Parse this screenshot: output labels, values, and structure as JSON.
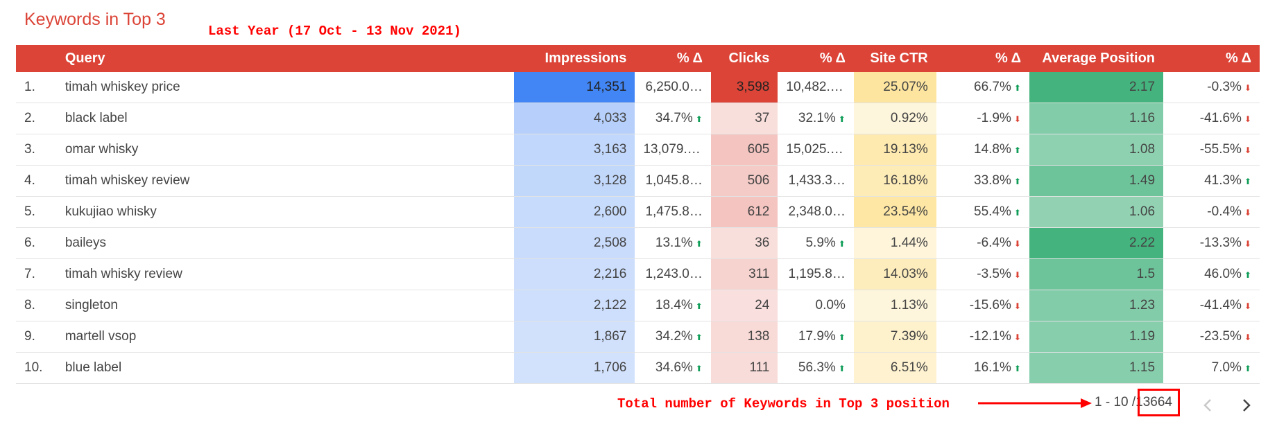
{
  "title": "Keywords in Top 3",
  "annotation_top": "Last Year (17 Oct - 13 Nov 2021)",
  "colors": {
    "header_bg": "#db4437",
    "annotation_red": "#ff0000",
    "impressions_rgb": "66,133,244",
    "clicks_rgb": "219,68,55",
    "ctr_rgb": "251,188,4",
    "position_rgb": "15,157,88"
  },
  "columns": [
    "Query",
    "Impressions",
    "% Δ",
    "Clicks",
    "% Δ",
    "Site CTR",
    "% Δ",
    "Average Position",
    "% Δ"
  ],
  "rows": [
    {
      "idx": "1.",
      "query": "timah whiskey price",
      "impressions": "14,351",
      "imp_delta": "6,250.0…",
      "clicks": "3,598",
      "clk_delta": "10,482.4…",
      "ctr": "25.07%",
      "ctr_delta": "66.7%",
      "ctr_dir": "up",
      "pos": "2.17",
      "pos_delta": "-0.3%",
      "pos_dir": "down",
      "imp_i": 1.0,
      "clk_i": 1.0,
      "ctr_i": 0.6,
      "pos_i": 0.75
    },
    {
      "idx": "2.",
      "query": "black label",
      "impressions": "4,033",
      "imp_delta": "34.7%",
      "imp_dir": "up",
      "clicks": "37",
      "clk_delta": "32.1%",
      "clk_dir": "up",
      "ctr": "0.92%",
      "ctr_delta": "-1.9%",
      "ctr_dir": "down",
      "pos": "1.16",
      "pos_delta": "-41.6%",
      "pos_dir": "down",
      "imp_i": 0.3,
      "clk_i": 0.06,
      "ctr_i": 0.05,
      "pos_i": 0.45
    },
    {
      "idx": "3.",
      "query": "omar whisky",
      "impressions": "3,163",
      "imp_delta": "13,079.2…",
      "clicks": "605",
      "clk_delta": "15,025.0…",
      "ctr": "19.13%",
      "ctr_delta": "14.8%",
      "ctr_dir": "up",
      "pos": "1.08",
      "pos_delta": "-55.5%",
      "pos_dir": "down",
      "imp_i": 0.24,
      "clk_i": 0.22,
      "ctr_i": 0.45,
      "pos_i": 0.4
    },
    {
      "idx": "4.",
      "query": "timah whiskey review",
      "impressions": "3,128",
      "imp_delta": "1,045.8…",
      "clicks": "506",
      "clk_delta": "1,433.3…",
      "ctr": "16.18%",
      "ctr_delta": "33.8%",
      "ctr_dir": "up",
      "pos": "1.49",
      "pos_delta": "41.3%",
      "pos_dir": "up",
      "imp_i": 0.23,
      "clk_i": 0.18,
      "ctr_i": 0.38,
      "pos_i": 0.55
    },
    {
      "idx": "5.",
      "query": "kukujiao whisky",
      "impressions": "2,600",
      "imp_delta": "1,475.8…",
      "clicks": "612",
      "clk_delta": "2,348.0…",
      "ctr": "23.54%",
      "ctr_delta": "55.4%",
      "ctr_dir": "up",
      "pos": "1.06",
      "pos_delta": "-0.4%",
      "pos_dir": "down",
      "imp_i": 0.2,
      "clk_i": 0.22,
      "ctr_i": 0.55,
      "pos_i": 0.38
    },
    {
      "idx": "6.",
      "query": "baileys",
      "impressions": "2,508",
      "imp_delta": "13.1%",
      "imp_dir": "up",
      "clicks": "36",
      "clk_delta": "5.9%",
      "clk_dir": "up",
      "ctr": "1.44%",
      "ctr_delta": "-6.4%",
      "ctr_dir": "down",
      "pos": "2.22",
      "pos_delta": "-13.3%",
      "pos_dir": "down",
      "imp_i": 0.19,
      "clk_i": 0.06,
      "ctr_i": 0.06,
      "pos_i": 0.75
    },
    {
      "idx": "7.",
      "query": "timah whisky review",
      "impressions": "2,216",
      "imp_delta": "1,243.0…",
      "clicks": "311",
      "clk_delta": "1,195.8…",
      "ctr": "14.03%",
      "ctr_delta": "-3.5%",
      "ctr_dir": "down",
      "pos": "1.5",
      "pos_delta": "46.0%",
      "pos_dir": "up",
      "imp_i": 0.17,
      "clk_i": 0.13,
      "ctr_i": 0.33,
      "pos_i": 0.55
    },
    {
      "idx": "8.",
      "query": "singleton",
      "impressions": "2,122",
      "imp_delta": "18.4%",
      "imp_dir": "up",
      "clicks": "24",
      "clk_delta": "0.0%",
      "ctr": "1.13%",
      "ctr_delta": "-15.6%",
      "ctr_dir": "down",
      "pos": "1.23",
      "pos_delta": "-41.4%",
      "pos_dir": "down",
      "imp_i": 0.16,
      "clk_i": 0.05,
      "ctr_i": 0.05,
      "pos_i": 0.45
    },
    {
      "idx": "9.",
      "query": "martell vsop",
      "impressions": "1,867",
      "imp_delta": "34.2%",
      "imp_dir": "up",
      "clicks": "138",
      "clk_delta": "17.9%",
      "clk_dir": "up",
      "ctr": "7.39%",
      "ctr_delta": "-12.1%",
      "ctr_dir": "down",
      "pos": "1.19",
      "pos_delta": "-23.5%",
      "pos_dir": "down",
      "imp_i": 0.14,
      "clk_i": 0.09,
      "ctr_i": 0.18,
      "pos_i": 0.43
    },
    {
      "idx": "10.",
      "query": "blue label",
      "impressions": "1,706",
      "imp_delta": "34.6%",
      "imp_dir": "up",
      "clicks": "111",
      "clk_delta": "56.3%",
      "clk_dir": "up",
      "ctr": "6.51%",
      "ctr_delta": "16.1%",
      "ctr_dir": "up",
      "pos": "1.15",
      "pos_delta": "7.0%",
      "pos_dir": "up",
      "imp_i": 0.13,
      "clk_i": 0.08,
      "ctr_i": 0.16,
      "pos_i": 0.43
    }
  ],
  "footer_annotation": "Total number of Keywords in Top 3 position",
  "pagination": {
    "range": "1 - 10 /",
    "total": "13664"
  },
  "icons": {
    "prev": "chevron-left-icon",
    "next": "chevron-right-icon",
    "up": "arrow-up-icon",
    "down": "arrow-down-icon"
  }
}
